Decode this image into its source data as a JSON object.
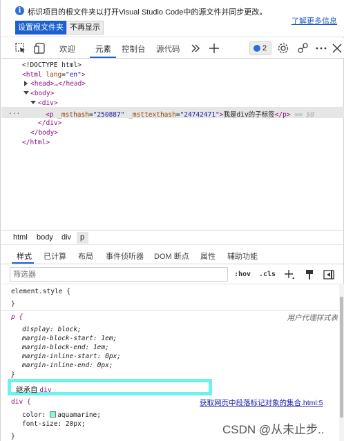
{
  "infobar": {
    "message": "标识项目的根文件夹以打开Visual Studio Code中的源文件并同步更改。",
    "learn_more": "了解更多信息",
    "set_root_button": "设置根文件夹",
    "dont_show_button": "不再显示"
  },
  "toolbar": {
    "tabs": [
      "欢迎",
      "元素",
      "控制台",
      "源代码"
    ],
    "active_tab": "元素",
    "issues_count": "2"
  },
  "dom": {
    "doctype": "<!DOCTYPE html>",
    "html_open_tag": "<html",
    "lang_attr": "lang",
    "lang_value": "\"en\"",
    "html_open_close": ">",
    "head_collapsed": "<head>…</head>",
    "body_open": "<body>",
    "div_open": "<div>",
    "p_open": "<p",
    "attr1_name": "_msthash",
    "attr1_value": "\"250887\"",
    "attr2_name": "_msttexthash",
    "attr2_value": "\"24742471\"",
    "p_close_bracket": ">",
    "p_text": "我是div的子标签",
    "p_close": "</p>",
    "selected_marker": "== $0",
    "div_close": "</div>",
    "body_close": "</body>",
    "html_close": "</html>",
    "ellipsis": "..."
  },
  "breadcrumb": [
    "html",
    "body",
    "div",
    "p"
  ],
  "styles_tabs": [
    "样式",
    "已计算",
    "布局",
    "事件侦听器",
    "DOM 断点",
    "属性",
    "辅助功能"
  ],
  "filter": {
    "placeholder": "筛选器",
    "hov": ":hov",
    "cls": ".cls"
  },
  "styles": {
    "element_style": "element.style {",
    "close_brace": "}",
    "p_selector": "p {",
    "user_agent_label": "用户代理样式表",
    "p_rules": [
      "display: block;",
      "margin-block-start: 1em;",
      "margin-block-end: 1em;",
      "margin-inline-start: 0px;",
      "margin-inline-end: 0px;"
    ],
    "inherited_label": "继承自",
    "inherited_tag": "div",
    "div_selector": "div {",
    "source_link": "获取网页中段落标记对象的集合.html:5",
    "div_color_prop": "color:",
    "div_color_value": "aquamarine;",
    "div_color_swatch": "#7fffd4",
    "div_font_size": "font-size: 20px;"
  },
  "watermark": "CSDN @从未止步.."
}
